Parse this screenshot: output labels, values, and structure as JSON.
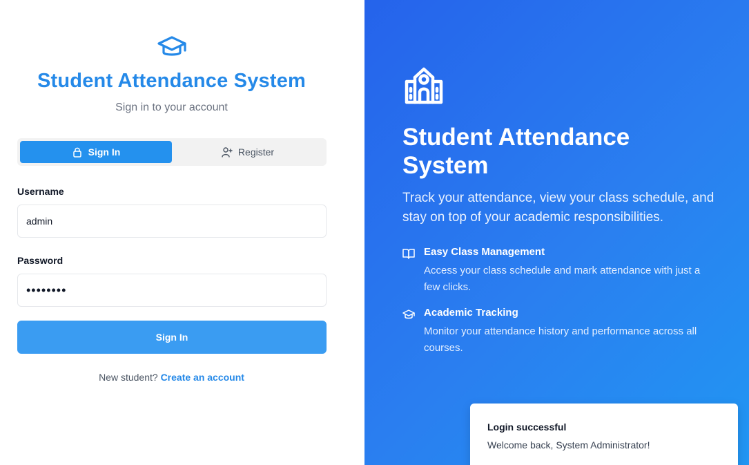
{
  "login": {
    "title": "Student Attendance System",
    "subtitle": "Sign in to your account",
    "tabs": [
      {
        "label": "Sign In",
        "icon": "lock-icon",
        "active": true
      },
      {
        "label": "Register",
        "icon": "user-plus-icon",
        "active": false
      }
    ],
    "username_label": "Username",
    "username_value": "admin",
    "password_label": "Password",
    "password_value": "••••••••",
    "submit_label": "Sign In",
    "footer_prompt": "New student?",
    "footer_link": "Create an account"
  },
  "hero": {
    "title": "Student Attendance System",
    "subtitle": "Track your attendance, view your class schedule, and stay on top of your academic responsibilities.",
    "features": [
      {
        "icon": "book-open-icon",
        "title": "Easy Class Management",
        "description": "Access your class schedule and mark attendance with just a few clicks."
      },
      {
        "icon": "graduation-cap-icon",
        "title": "Academic Tracking",
        "description": "Monitor your attendance history and performance across all courses."
      }
    ]
  },
  "toast": {
    "title": "Login successful",
    "description": "Welcome back, System Administrator!"
  },
  "colors": {
    "accent": "#2589e8",
    "tab_active": "#2491ee",
    "button": "#3a9cf2",
    "hero_gradient_start": "#2563eb",
    "hero_gradient_end": "#2196f3"
  }
}
